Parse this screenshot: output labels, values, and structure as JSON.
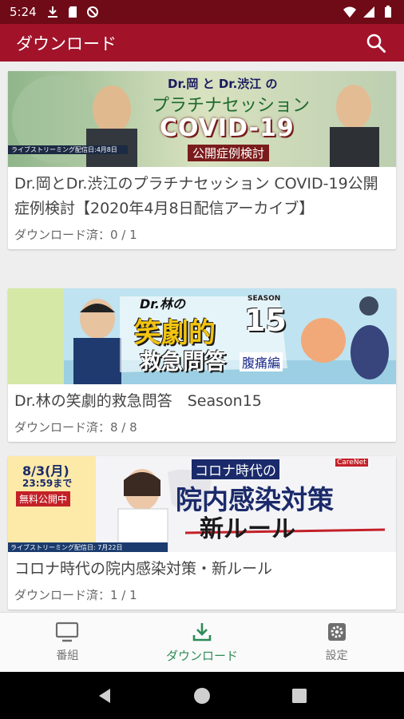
{
  "status_bar": {
    "time": "5:24",
    "left_icons": [
      "download-icon",
      "sd-card-icon",
      "no-sync-icon"
    ],
    "right_icons": [
      "wifi-icon",
      "signal-icon",
      "battery-icon"
    ]
  },
  "app_bar": {
    "title": "ダウンロード",
    "search_icon": "search-icon"
  },
  "colors": {
    "app_bar": "#a2132a",
    "status_bar": "#6f0a17",
    "active_nav": "#2e8b57"
  },
  "programs": [
    {
      "title": "Dr.岡とDr.渋江のプラチナセッション COVID-19公開症例検討【2020年4月8日配信アーカイブ】",
      "status": "ダウンロード済：0 / 1",
      "thumb": {
        "line1": "Dr.岡 と Dr.渋江 の",
        "line2": "プラチナセッション",
        "line3": "COVID-19",
        "line4": "公開症例検討",
        "badge": "ライブストリーミング配信日:4月8日"
      }
    },
    {
      "title": "Dr.林の笑劇的救急問答　Season15",
      "status": "ダウンロード済：8 / 8",
      "thumb": {
        "line1": "Dr.林の",
        "line2": "笑劇的",
        "line3": "救急問答",
        "season_label": "SEASON",
        "season": "15",
        "sub": "腹痛編"
      }
    },
    {
      "title": "コロナ時代の院内感染対策・新ルール",
      "status": "ダウンロード済：1 / 1",
      "thumb": {
        "date": "8/3(月)",
        "time": "23:59まで",
        "free": "無料公開中",
        "line1": "コロナ時代の",
        "line2": "院内感染対策",
        "line3": "新ルール",
        "brand": "CareNet",
        "badge": "ライブストリーミング配信日: 7月22日"
      }
    }
  ],
  "bottom_nav": [
    {
      "label": "番組",
      "icon": "tv-icon",
      "active": false
    },
    {
      "label": "ダウンロード",
      "icon": "download-icon",
      "active": true
    },
    {
      "label": "設定",
      "icon": "gear-icon",
      "active": false
    }
  ],
  "system_nav": [
    "back-icon",
    "home-icon",
    "recents-icon"
  ]
}
